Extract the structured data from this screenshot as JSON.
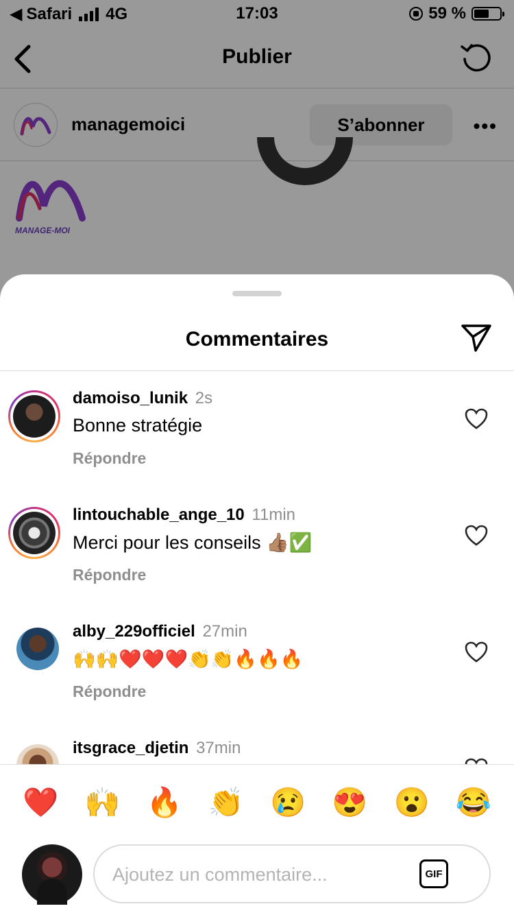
{
  "status_bar": {
    "back_app": "Safari",
    "network": "4G",
    "time": "17:03",
    "battery_text": "59 %",
    "battery_level": 0.59
  },
  "navbar": {
    "title": "Publier"
  },
  "post": {
    "username": "managemoici",
    "follow_label": "S’abonner",
    "more_label": "•••",
    "logo_text": "MANAGE-MOI"
  },
  "comments_sheet": {
    "title": "Commentaires",
    "reply_label": "Répondre",
    "comments": [
      {
        "username": "damoiso_lunik",
        "time": "2s",
        "text": "Bonne stratégie",
        "ring": true
      },
      {
        "username": "lintouchable_ange_10",
        "time": "11min",
        "text": "Merci pour les conseils 👍🏽✅",
        "ring": true
      },
      {
        "username": "alby_229officiel",
        "time": "27min",
        "text": "🙌🙌❤️❤️❤️👏👏🔥🔥🔥",
        "ring": false
      },
      {
        "username": "itsgrace_djetin",
        "time": "37min",
        "text": "",
        "ring": false
      }
    ]
  },
  "composer": {
    "quick_emojis": [
      "❤️",
      "🙌",
      "🔥",
      "👏",
      "😢",
      "😍",
      "😮",
      "😂"
    ],
    "placeholder": "Ajoutez un commentaire...",
    "gif_label": "GIF"
  },
  "colors": {
    "ring_gradient": [
      "#c13584",
      "#e1306c",
      "#f77737",
      "#fcaf45",
      "#833ab4"
    ],
    "muted_text": "#8e8e8e",
    "follow_bg": "#efefef"
  },
  "icons": {
    "back": "chevron-left-icon",
    "refresh": "refresh-icon",
    "send": "paper-plane-icon",
    "like": "heart-outline-icon",
    "gif": "gif-icon"
  }
}
